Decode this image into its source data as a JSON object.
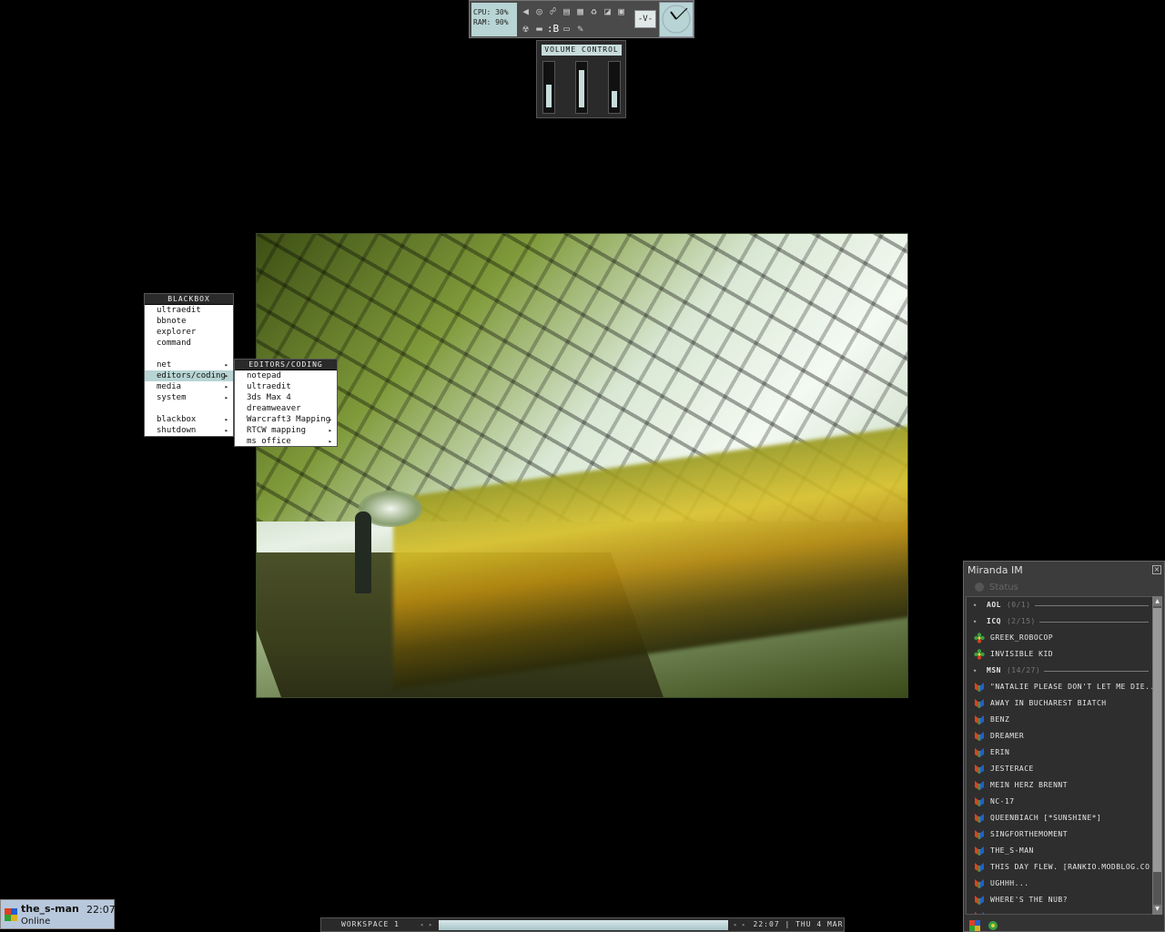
{
  "sysmon": {
    "cpu": "CPU: 30%",
    "ram": "RAM: 90%",
    "v_label": "-V-",
    "icons": [
      "speaker-icon",
      "cd-icon",
      "network-icon",
      "chart-icon",
      "windows-icon",
      "recycle-icon",
      "graph-icon",
      "tray-icon",
      "radioactive-icon",
      "disk-icon",
      "b-icon",
      "monitor-icon",
      "pen-icon"
    ],
    "b_label": ":B"
  },
  "volume": {
    "title": "VOLUME CONTROL",
    "levels": [
      0.55,
      0.9,
      0.4
    ]
  },
  "menu": {
    "title": "BLACKBOX",
    "items": [
      {
        "label": "ultraedit",
        "submenu": false
      },
      {
        "label": "bbnote",
        "submenu": false
      },
      {
        "label": "explorer",
        "submenu": false
      },
      {
        "label": "command",
        "submenu": false
      },
      {
        "label": "",
        "gap": true
      },
      {
        "label": "net",
        "submenu": true
      },
      {
        "label": "editors/coding",
        "submenu": true,
        "selected": true
      },
      {
        "label": "media",
        "submenu": true
      },
      {
        "label": "system",
        "submenu": true
      },
      {
        "label": "",
        "gap": true
      },
      {
        "label": "blackbox",
        "submenu": true
      },
      {
        "label": "shutdown",
        "submenu": true
      }
    ]
  },
  "submenu": {
    "title": "EDITORS/CODING",
    "items": [
      {
        "label": "notepad",
        "submenu": false
      },
      {
        "label": "ultraedit",
        "submenu": false
      },
      {
        "label": "3ds Max 4",
        "submenu": false
      },
      {
        "label": "dreamweaver",
        "submenu": false
      },
      {
        "label": "Warcraft3 Mapping",
        "submenu": true
      },
      {
        "label": "RTCW mapping",
        "submenu": true
      },
      {
        "label": "ms office",
        "submenu": true
      }
    ]
  },
  "miranda": {
    "title": "Miranda IM",
    "status": "Status",
    "rows": [
      {
        "type": "group",
        "name": "AOL",
        "count": "(0/1)"
      },
      {
        "type": "group",
        "name": "ICQ",
        "count": "(2/15)"
      },
      {
        "type": "contact",
        "proto": "icq",
        "name": "GREEK_ROBOCOP"
      },
      {
        "type": "contact",
        "proto": "icq",
        "name": "INVISIBLE KID"
      },
      {
        "type": "group",
        "name": "MSN",
        "count": "(14/27)"
      },
      {
        "type": "contact",
        "proto": "msn",
        "name": "\"NATALIE PLEASE DON'T LET ME DIE..."
      },
      {
        "type": "contact",
        "proto": "msn",
        "name": "AWAY IN BUCHAREST BIATCH"
      },
      {
        "type": "contact",
        "proto": "msn",
        "name": "BENZ"
      },
      {
        "type": "contact",
        "proto": "msn",
        "name": "DREAMER"
      },
      {
        "type": "contact",
        "proto": "msn",
        "name": "ERIN"
      },
      {
        "type": "contact",
        "proto": "msn",
        "name": "JESTERACE"
      },
      {
        "type": "contact",
        "proto": "msn",
        "name": "MEIN HERZ BRENNT"
      },
      {
        "type": "contact",
        "proto": "msn",
        "name": "NC-17"
      },
      {
        "type": "contact",
        "proto": "msn",
        "name": "QUEENBIACH [*SUNSHINE*]"
      },
      {
        "type": "contact",
        "proto": "msn",
        "name": "SINGFORTHEMOMENT"
      },
      {
        "type": "contact",
        "proto": "msn",
        "name": "THE_S-MAN"
      },
      {
        "type": "contact",
        "proto": "msn",
        "name": "THIS DAY FLEW. [RANKIO.MODBLOG.CO"
      },
      {
        "type": "contact",
        "proto": "msn",
        "name": "UGHHH..."
      },
      {
        "type": "contact",
        "proto": "msn",
        "name": "WHERE'S THE NUB?"
      },
      {
        "type": "contact",
        "proto": "msn",
        "name": "..."
      }
    ]
  },
  "tray": {
    "user": "the_s-man",
    "time": "22:07",
    "status": "Online"
  },
  "toolbar": {
    "workspace": "WORKSPACE 1",
    "clock": "22:07 | THU 4 MAR"
  },
  "colors": {
    "accent": "#b8d4d4",
    "icq": "#3aa040",
    "msn_a": "#e04020",
    "msn_b": "#2060d0",
    "msn_c": "#30a030",
    "msn_d": "#e0b020"
  }
}
